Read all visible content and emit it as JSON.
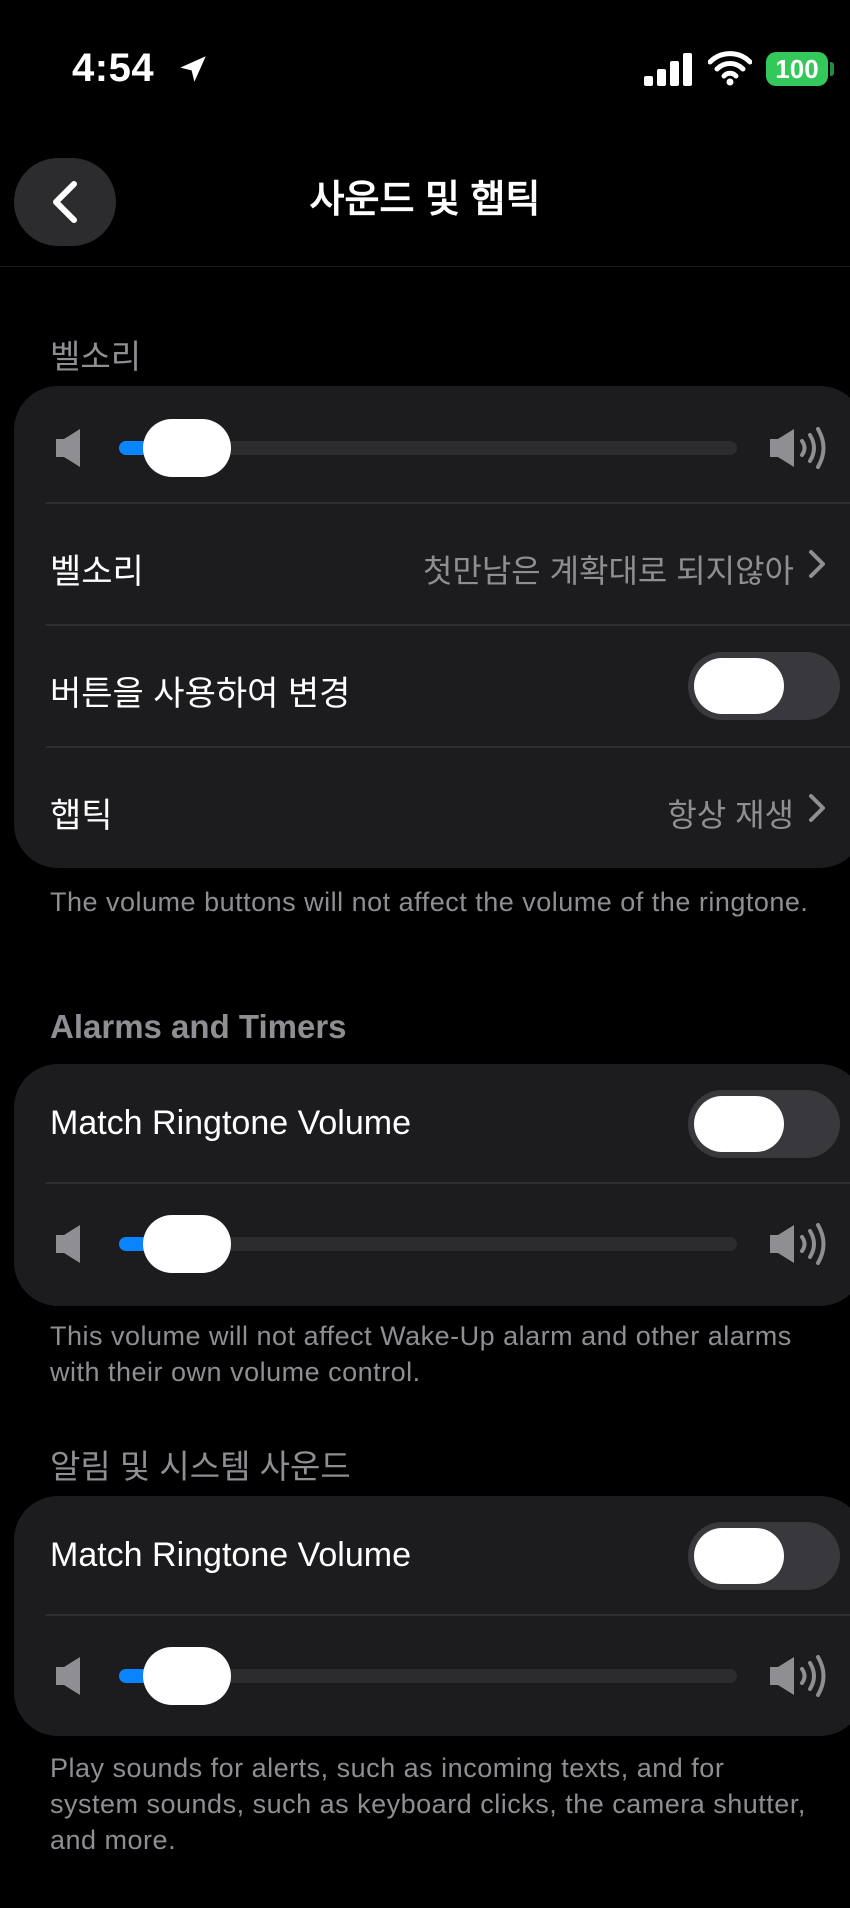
{
  "status_bar": {
    "time": "4:54",
    "battery": "100",
    "location_icon": "location-arrow-icon",
    "signal_icon": "cellular-signal-icon",
    "wifi_icon": "wifi-icon"
  },
  "nav": {
    "title": "사운드 및 햅틱",
    "back_icon": "chevron-left-icon"
  },
  "ringtone_section": {
    "header": "벨소리",
    "volume_level": 0.06,
    "ringtone_label": "벨소리",
    "ringtone_value": "첫만남은 계확대로 되지않아",
    "change_with_buttons_label": "버튼을 사용하여 변경",
    "change_with_buttons_on": false,
    "haptics_label": "햅틱",
    "haptics_value": "항상 재생",
    "footer": "The volume buttons will not affect the volume of the ringtone."
  },
  "alarms_section": {
    "header": "Alarms and Timers",
    "match_label": "Match Ringtone Volume",
    "match_on": false,
    "volume_level": 0.06,
    "footer": "This volume will not affect Wake-Up alarm and other alarms with their own volume control."
  },
  "notifications_section": {
    "header": "알림 및 시스템 사운드",
    "match_label": "Match Ringtone Volume",
    "match_on": false,
    "volume_level": 0.06,
    "footer": "Play sounds for alerts, such as incoming texts, and for system sounds, such as keyboard clicks, the camera shutter, and more."
  },
  "colors": {
    "background": "#000000",
    "card": "#1c1c1e",
    "accent": "#0a84ff",
    "battery": "#34c759",
    "secondary_text": "#8e8e93"
  }
}
